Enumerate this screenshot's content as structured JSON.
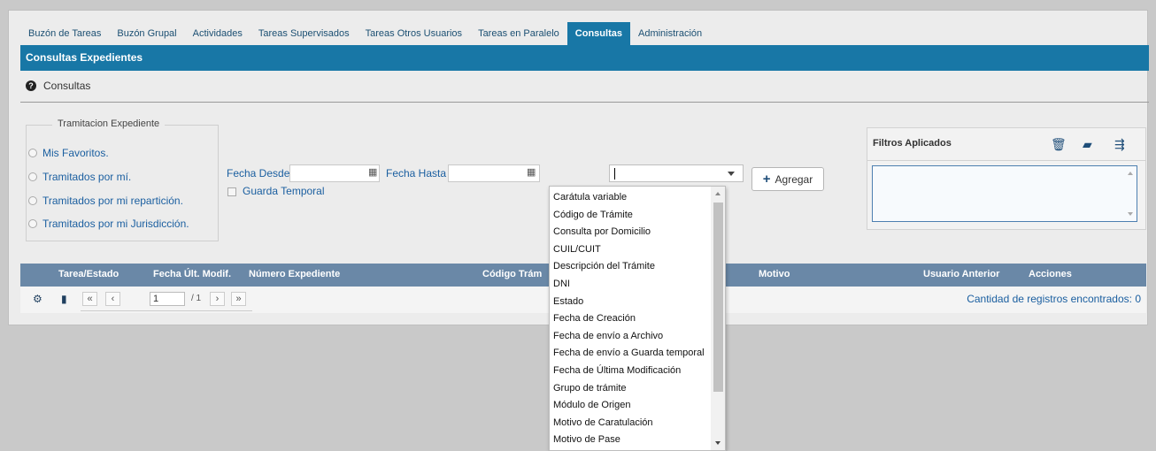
{
  "tabs": [
    {
      "label": "Buzón de Tareas"
    },
    {
      "label": "Buzón Grupal"
    },
    {
      "label": "Actividades"
    },
    {
      "label": "Tareas Supervisados"
    },
    {
      "label": "Tareas Otros Usuarios"
    },
    {
      "label": "Tareas en Paralelo"
    },
    {
      "label": "Consultas"
    },
    {
      "label": "Administración"
    }
  ],
  "active_tab": "Consultas",
  "panel": {
    "title": "Consultas Expedientes",
    "subtitle": "Consultas",
    "help_icon": "question-circle-icon"
  },
  "tramitacion": {
    "legend": "Tramitacion Expediente",
    "options": [
      {
        "label": "Mis Favoritos."
      },
      {
        "label": "Tramitados por mí."
      },
      {
        "label": "Tramitados por mi repartición."
      },
      {
        "label": "Tramitados por mi Jurisdicción."
      }
    ]
  },
  "dates": {
    "desde_label": "Fecha Desde",
    "desde_value": "",
    "hasta_label": "Fecha Hasta",
    "hasta_value": "",
    "calendar_icon": "calendar-icon"
  },
  "guarda_temporal": {
    "label": "Guarda Temporal",
    "checked": false
  },
  "filter_select": {
    "value": ""
  },
  "add_button": {
    "label": "Agregar",
    "icon": "plus-icon"
  },
  "filtros": {
    "title": "Filtros Aplicados",
    "icons": [
      "trash-icon",
      "folder-open-icon",
      "save-filter-icon"
    ]
  },
  "grid": {
    "columns": [
      "Tarea/Estado",
      "Fecha Últ. Modif.",
      "Número Expediente",
      "Código Trám",
      "Motivo",
      "Usuario Anterior",
      "Acciones"
    ]
  },
  "pager": {
    "current_page": "1",
    "total": "/ 1",
    "records_text": "Cantidad de registros encontrados: 0",
    "icons": [
      "gear-icon",
      "file-icon"
    ],
    "nav": [
      "«",
      "‹",
      "›",
      "»"
    ]
  },
  "dropdown": {
    "items": [
      "Carátula variable",
      "Código de Trámite",
      "Consulta por Domicilio",
      "CUIL/CUIT",
      "Descripción del Trámite",
      "DNI",
      "Estado",
      "Fecha de Creación",
      "Fecha de envío a Archivo",
      "Fecha de envío a Guarda temporal",
      "Fecha de Última Modificación",
      "Grupo de trámite",
      "Módulo de Origen",
      "Motivo de Caratulación",
      "Motivo de Pase"
    ]
  },
  "colors": {
    "header_blue": "#1877a6",
    "grid_header": "#6a88a7",
    "link_blue": "#1b5fa0"
  }
}
